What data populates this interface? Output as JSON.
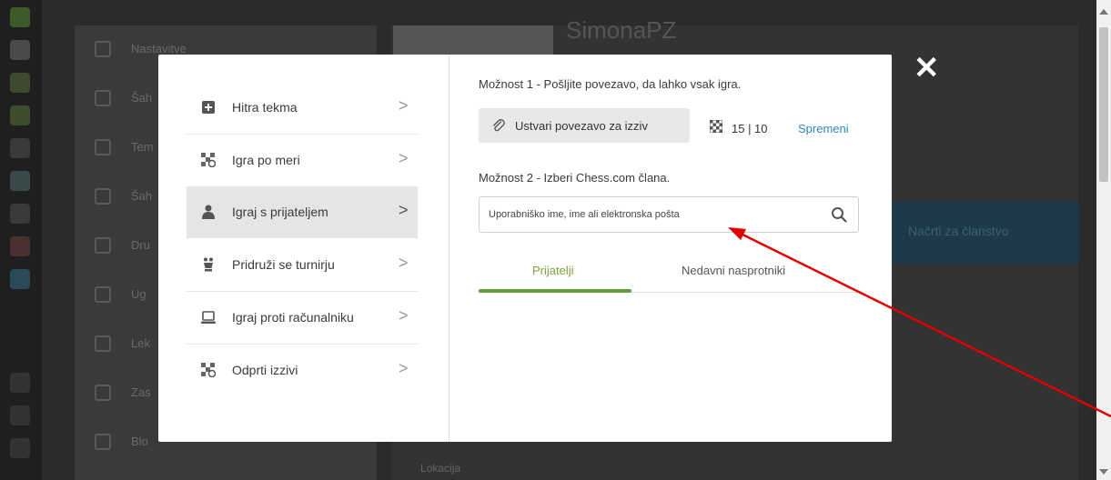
{
  "background": {
    "menu_items": [
      "Nastavitve",
      "Šah",
      "Tem",
      "Šah",
      "Dru",
      "Ug",
      "Lek",
      "Zas",
      "Blo"
    ],
    "profile_name": "SimonaPZ",
    "banner": "Načrti za članstvo",
    "location_label": "Lokacija"
  },
  "modal": {
    "close_symbol": "✕",
    "left_menu": [
      {
        "label": "Hitra tekma",
        "icon": "plus-square-icon"
      },
      {
        "label": "Igra po meri",
        "icon": "custom-board-icon"
      },
      {
        "label": "Igraj s prijateljem",
        "icon": "person-icon",
        "active": true
      },
      {
        "label": "Pridruži se turnirju",
        "icon": "trophy-icon"
      },
      {
        "label": "Igraj proti računalniku",
        "icon": "laptop-icon"
      },
      {
        "label": "Odprti izzivi",
        "icon": "open-challenges-icon"
      }
    ],
    "chevron": ">",
    "option1_label": "Možnost 1 - Pošljite povezavo, da lahko vsak igra.",
    "create_link_label": "Ustvari povezavo za izziv",
    "time_control": "15 | 10",
    "change_label": "Spremeni",
    "option2_label": "Možnost 2 - Izberi Chess.com člana.",
    "search_placeholder": "Uporabniško ime, ime ali elektronska pošta",
    "tabs": [
      {
        "label": "Prijatelji",
        "active": true
      },
      {
        "label": "Nedavni nasprotniki",
        "active": false
      }
    ]
  },
  "colors": {
    "accent_green": "#5fa036",
    "link_blue": "#2f86c4",
    "annotation_red": "#e00000"
  }
}
